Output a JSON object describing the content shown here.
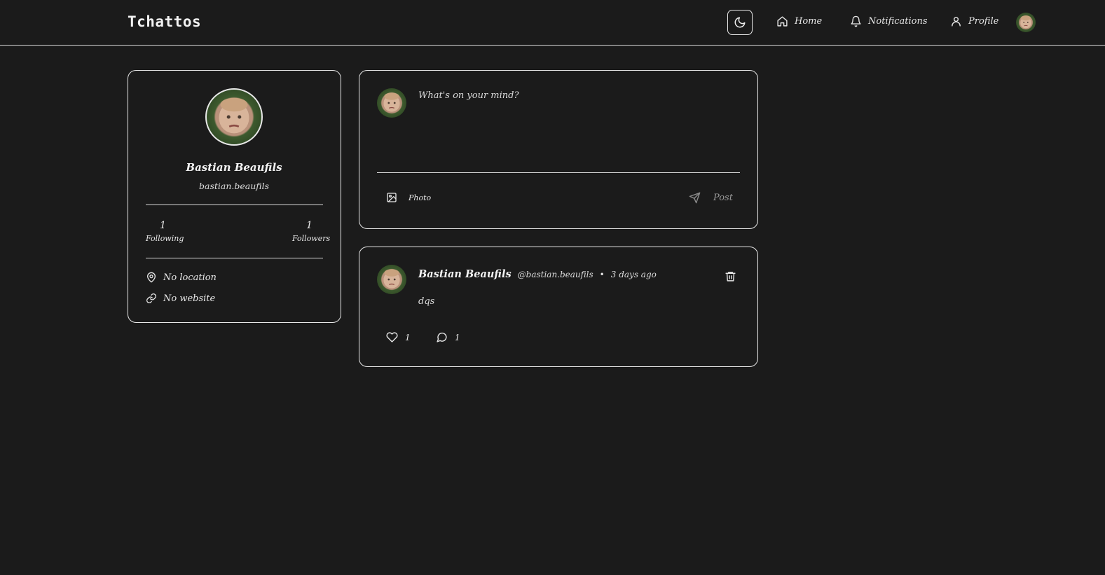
{
  "header": {
    "brand": "Tchattos",
    "nav": {
      "home": "Home",
      "notifications": "Notifications",
      "profile": "Profile"
    }
  },
  "profile": {
    "name": "Bastian Beaufils",
    "username": "bastian.beaufils",
    "following_count": "1",
    "following_label": "Following",
    "followers_count": "1",
    "followers_label": "Followers",
    "location": "No location",
    "website": "No website"
  },
  "composer": {
    "placeholder": "What's on your mind?",
    "photo_label": "Photo",
    "post_label": "Post"
  },
  "post": {
    "author_name": "Bastian Beaufils",
    "author_handle": "@bastian.beaufils",
    "separator": "•",
    "time": "3 days ago",
    "content": "dqs",
    "likes": "1",
    "comments": "1"
  },
  "icons": [
    "moon-icon",
    "home-icon",
    "bell-icon",
    "user-icon",
    "map-pin-icon",
    "link-icon",
    "image-icon",
    "send-icon",
    "trash-icon",
    "heart-icon",
    "comment-icon"
  ],
  "colors": {
    "background": "#1b1b1b",
    "border": "#e8e8e8",
    "text": "#e8e8e8"
  }
}
